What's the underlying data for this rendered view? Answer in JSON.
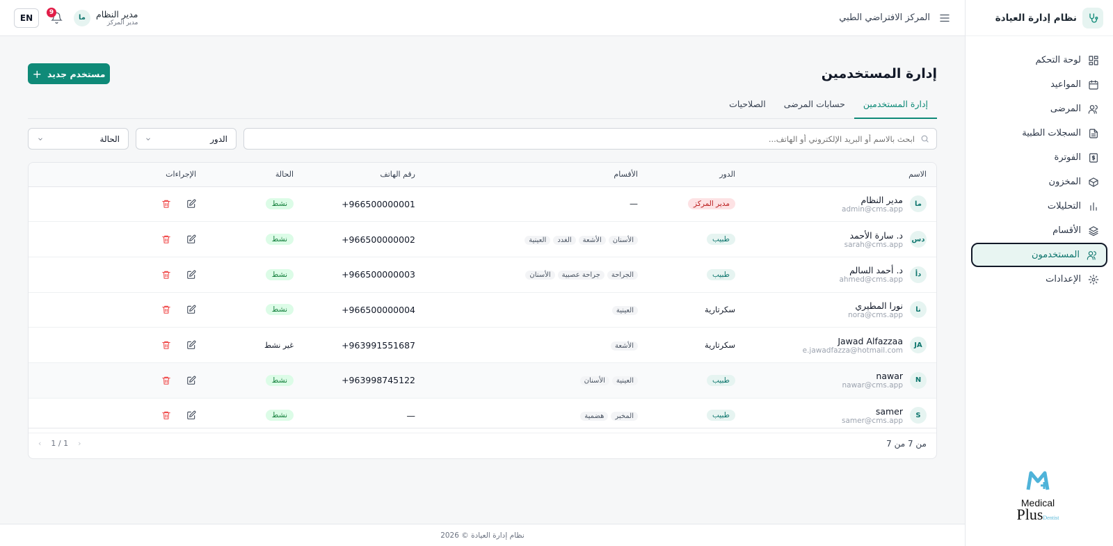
{
  "sidebar": {
    "brand_title": "نظام إدارة العيادة",
    "items": [
      {
        "label": "لوحة التحكم",
        "icon": "dashboard-icon"
      },
      {
        "label": "المواعيد",
        "icon": "calendar-icon"
      },
      {
        "label": "المرضى",
        "icon": "users-icon"
      },
      {
        "label": "السجلات الطبية",
        "icon": "file-icon"
      },
      {
        "label": "الفوترة",
        "icon": "dollar-icon"
      },
      {
        "label": "المخزون",
        "icon": "box-icon"
      },
      {
        "label": "التحليلات",
        "icon": "chart-icon"
      },
      {
        "label": "الأقسام",
        "icon": "layers-icon"
      },
      {
        "label": "المستخدمون",
        "icon": "users-icon"
      },
      {
        "label": "الإعدادات",
        "icon": "gear-icon"
      }
    ],
    "logo_line1": "Medical",
    "logo_line2": "Plus",
    "logo_small": "Dentist"
  },
  "topbar": {
    "clinic_name": "المركز الافتراضي الطبي",
    "user_name": "مدير النظام",
    "user_role": "مدير المركز",
    "user_initials": "ما",
    "notifications": "9",
    "lang": "EN"
  },
  "page": {
    "title": "إدارة المستخدمين",
    "new_button": "مستخدم جديد",
    "tabs": [
      "إدارة المستخدمين",
      "حسابات المرضى",
      "الصلاحيات"
    ]
  },
  "filters": {
    "search_placeholder": "ابحث بالاسم أو البريد الإلكتروني أو الهاتف...",
    "role_select": "الدور",
    "status_select": "الحالة"
  },
  "table": {
    "headers": {
      "name": "الاسم",
      "role": "الدور",
      "departments": "الأقسام",
      "phone": "رقم الهاتف",
      "status": "الحالة",
      "actions": "الإجراءات"
    },
    "rows": [
      {
        "initials": "ما",
        "name": "مدير النظام",
        "email": "admin@cms.app",
        "role": "مدير المركز",
        "departments_text": "—",
        "phone": "+966500000001",
        "status": "نشط"
      },
      {
        "initials": "دس",
        "name": "د. سارة الأحمد",
        "email": "sarah@cms.app",
        "role": "طبيب",
        "departments": [
          "الأسنان",
          "الأشعة",
          "الغدد",
          "العينية"
        ],
        "phone": "+966500000002",
        "status": "نشط"
      },
      {
        "initials": "دأ",
        "name": "د. أحمد السالم",
        "email": "ahmed@cms.app",
        "role": "طبيب",
        "departments": [
          "الجراحة",
          "جراحة عصبية",
          "الأسنان"
        ],
        "phone": "+966500000003",
        "status": "نشط"
      },
      {
        "initials": "نا",
        "name": "نورا المطيري",
        "email": "nora@cms.app",
        "role": "سكرتارية",
        "departments": [
          "العينية"
        ],
        "phone": "+966500000004",
        "status": "نشط"
      },
      {
        "initials": "JA",
        "name": "Jawad Alfazzaa",
        "email": "e.jawadfazza@hotmail.com",
        "role": "سكرتارية",
        "departments": [
          "الأشعة"
        ],
        "phone": "+963991551687",
        "status": "غير نشط"
      },
      {
        "initials": "N",
        "name": "nawar",
        "email": "nawar@cms.app",
        "role": "طبيب",
        "departments": [
          "العينية",
          "الأسنان"
        ],
        "phone": "+963998745122",
        "status": "نشط"
      },
      {
        "initials": "S",
        "name": "samer",
        "email": "samer@cms.app",
        "role": "طبيب",
        "departments": [
          "المخبر",
          "هضمية"
        ],
        "phone": "—",
        "status": "نشط"
      }
    ]
  },
  "pagination": {
    "info": "من 7 من 7",
    "page": "1 / 1",
    "prev": "‹",
    "next": "›"
  },
  "footer": "نظام إدارة العيادة © 2026"
}
